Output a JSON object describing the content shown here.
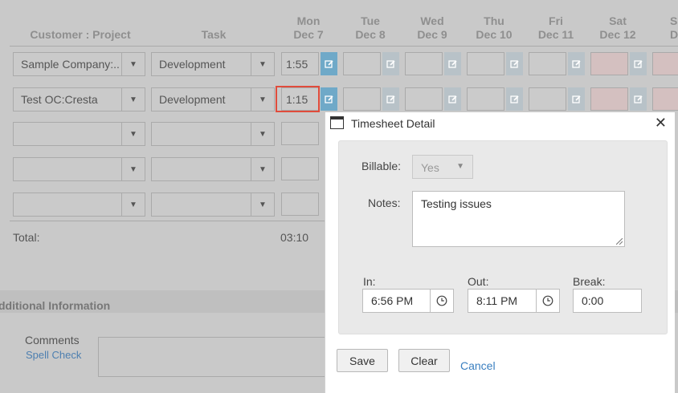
{
  "grid": {
    "headers": {
      "customer_project": "Customer : Project",
      "task": "Task"
    },
    "days": [
      {
        "day": "Mon",
        "date": "Dec 7"
      },
      {
        "day": "Tue",
        "date": "Dec 8"
      },
      {
        "day": "Wed",
        "date": "Dec 9"
      },
      {
        "day": "Thu",
        "date": "Dec 10"
      },
      {
        "day": "Fri",
        "date": "Dec 11"
      },
      {
        "day": "Sat",
        "date": "Dec 12"
      },
      {
        "day": "S",
        "date": "De"
      }
    ],
    "rows": [
      {
        "customer": "Sample Company:...",
        "task": "Development",
        "mon": "1:55"
      },
      {
        "customer": "Test OC:Cresta",
        "task": "Development",
        "mon": "1:15"
      },
      {
        "customer": "",
        "task": "",
        "mon": ""
      },
      {
        "customer": "",
        "task": "",
        "mon": ""
      },
      {
        "customer": "",
        "task": "",
        "mon": ""
      }
    ],
    "total_label": "Total:",
    "total_value": "03:10"
  },
  "additional": {
    "title": "dditional Information",
    "comments_label": "Comments",
    "spell_check": "Spell Check"
  },
  "dialog": {
    "title": "Timesheet Detail",
    "billable_label": "Billable:",
    "billable_value": "Yes",
    "notes_label": "Notes:",
    "notes_value": "Testing issues",
    "in_label": "In:",
    "in_value": "6:56 PM",
    "out_label": "Out:",
    "out_value": "8:11 PM",
    "break_label": "Break:",
    "break_value": "0:00",
    "save": "Save",
    "clear": "Clear",
    "cancel": "Cancel"
  }
}
